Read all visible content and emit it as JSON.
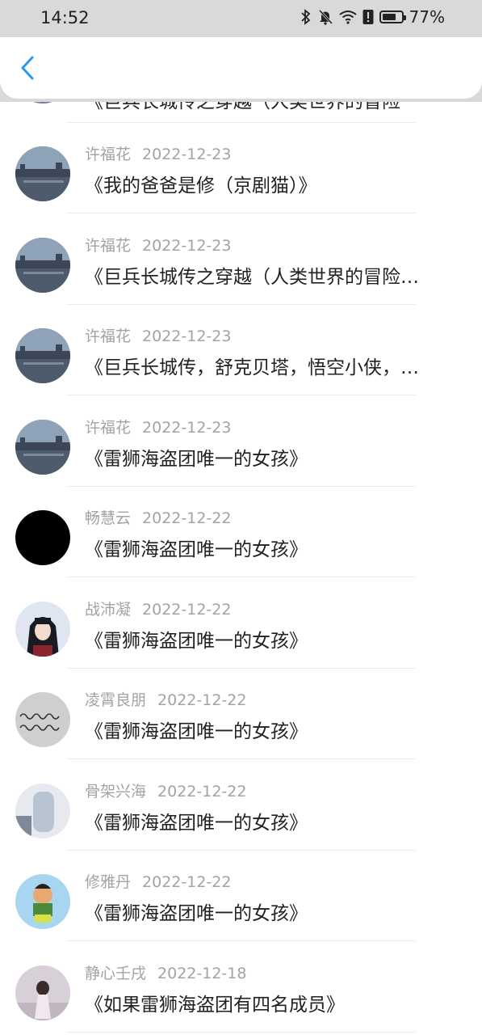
{
  "status_bar": {
    "time": "14:52",
    "battery": "77%",
    "battery_level": 0.77
  },
  "header": {
    "back_icon": "chevron-left-icon"
  },
  "partial_item": {
    "title": "《巨兵长城传之穿越（人类世界的冒险"
  },
  "items": [
    {
      "name": "许福花",
      "date": "2022-12-23",
      "title": "《我的爸爸是修（京剧猫）》",
      "avatar": "great-wall-photo"
    },
    {
      "name": "许福花",
      "date": "2022-12-23",
      "title": "《巨兵长城传之穿越（人类世界的冒险…",
      "avatar": "great-wall-photo"
    },
    {
      "name": "许福花",
      "date": "2022-12-23",
      "title": "《巨兵长城传，舒克贝塔，悟空小侠，…",
      "avatar": "great-wall-photo"
    },
    {
      "name": "许福花",
      "date": "2022-12-23",
      "title": "《雷狮海盗团唯一的女孩》",
      "avatar": "great-wall-photo"
    },
    {
      "name": "畅慧云",
      "date": "2022-12-22",
      "title": "《雷狮海盗团唯一的女孩》",
      "avatar": "black-circle"
    },
    {
      "name": "战沛凝",
      "date": "2022-12-22",
      "title": "《雷狮海盗团唯一的女孩》",
      "avatar": "anime-character"
    },
    {
      "name": "凌霄良朋",
      "date": "2022-12-22",
      "title": "《雷狮海盗团唯一的女孩》",
      "avatar": "handwriting-note"
    },
    {
      "name": "骨架兴海",
      "date": "2022-12-22",
      "title": "《雷狮海盗团唯一的女孩》",
      "avatar": "blurred-photo"
    },
    {
      "name": "修雅丹",
      "date": "2022-12-22",
      "title": "《雷狮海盗团唯一的女孩》",
      "avatar": "cartoon-boy"
    },
    {
      "name": "静心壬戌",
      "date": "2022-12-18",
      "title": "《如果雷狮海盗团有四名成员》",
      "avatar": "girl-photo"
    }
  ]
}
